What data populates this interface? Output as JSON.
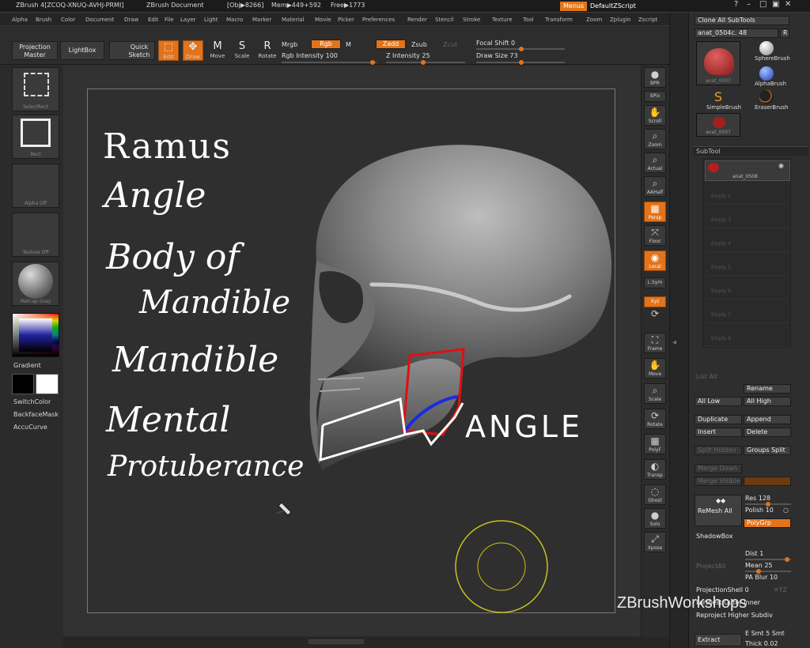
{
  "titlebar": {
    "app": "ZBrush 4[ZCOQ-XNUQ-AVHJ-PRMI]",
    "doc": "ZBrush Document",
    "obj": "[Obj▶8266]",
    "mem": "Mem▶449+592",
    "free": "Free▶1773",
    "menus_btn": "Menus",
    "script_btn": "DefaultZScript"
  },
  "menubar": [
    "Alpha",
    "Brush",
    "Color",
    "Document",
    "Draw",
    "Edit",
    "File",
    "Layer",
    "Light",
    "Macro",
    "Marker",
    "Material",
    "Movie",
    "Picker",
    "Preferences",
    "Render",
    "Stencil",
    "Stroke",
    "Texture",
    "Tool",
    "Transform",
    "Zoom",
    "Zplugin",
    "Zscript"
  ],
  "toolbar": {
    "projection_master": "Projection Master",
    "lightbox": "LightBox",
    "quick_sketch": "Quick Sketch",
    "edit": "Edit",
    "draw": "Draw",
    "move": "Move",
    "scale": "Scale",
    "rotate": "Rotate",
    "mrgb": "Mrgb",
    "rgb": "Rgb",
    "m": "M",
    "zadd": "Zadd",
    "zsub": "Zsub",
    "zcut": "Zcut",
    "rgb_intensity": "Rgb Intensity 100",
    "z_intensity": "Z Intensity 25",
    "focal_shift": "Focal Shift 0",
    "draw_size": "Draw Size 73"
  },
  "left_shelf": {
    "stroke_caption": "SelectRect",
    "alpha_caption": "Rect",
    "alpha_off": "Alpha Off",
    "texture_off": "Texture Off",
    "material": "Matcap Gray",
    "gradient": "Gradient",
    "switch_color": "SwitchColor",
    "backface": "BackfaceMask",
    "accucurve": "AccuCurve"
  },
  "right_shelf": [
    "BPR",
    "SPix",
    "Scroll",
    "Zoom",
    "Actual",
    "AAHalf",
    "Persp",
    "Floor",
    "Local",
    "L.Sym",
    "Xyz",
    "",
    "Frame",
    "Move",
    "Scale",
    "Rotate",
    "PolyF",
    "Transp",
    "Ghost",
    "Solo",
    "Xpose"
  ],
  "tray": {
    "clone_all": "Clone  All SubTools",
    "tool_name": "anat_0504c. 48",
    "r": "R",
    "brushes": [
      "SphereBrush",
      "AlphaBrush",
      "SimpleBrush",
      "EraserBrush"
    ],
    "thumb1": "anat_0507",
    "thumb2": "anat_0507",
    "subtool_header": "SubTool",
    "subtool_active": "anat_0508",
    "subtool_empty": [
      "Empty 2",
      "Empty 3",
      "Empty 4",
      "Empty 5",
      "Empty 6",
      "Empty 7",
      "Empty 8"
    ],
    "list_all": "List All",
    "rename": "Rename",
    "all_low": "All Low",
    "all_high": "All High",
    "duplicate": "Duplicate",
    "append": "Append",
    "insert": "Insert",
    "delete": "Delete",
    "split_hidden": "Split Hidden",
    "groups_split": "Groups Split",
    "merge_down": "Merge Down",
    "merge_visible": "Merge Visible",
    "remesh_all": "ReMesh All",
    "res": "Res 128",
    "polish": "Polish 10",
    "polygrp": "PolyGrp",
    "shadowbox": "ShadowBox",
    "project_all": "ProjectAll",
    "dist": "Dist 1",
    "mean": "Mean 25",
    "pa_blur": "PA Blur 10",
    "projection_shell": "ProjectionShell 0",
    "farthest": "Farthest Outer Inner",
    "reproject": "Reproject Higher Subdiv",
    "extract": "Extract",
    "e_smt": "E Smt 5 Smt",
    "thick": "Thick 0.02"
  },
  "annotations": {
    "notes": [
      "Ramus",
      "Angle",
      "Body of",
      "Mandible",
      "Mandible",
      "Mental",
      "Protuberance"
    ],
    "angle_label": "ANGLE"
  },
  "watermark": "ZBrushWorkshops",
  "colors": {
    "accent": "#e2731a",
    "ink": "#ffffff",
    "red_outline": "#e01010",
    "blue_outline": "#1a2be0"
  }
}
